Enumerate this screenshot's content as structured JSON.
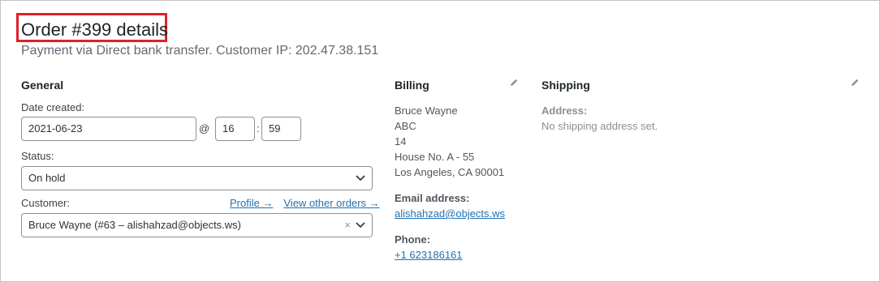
{
  "order": {
    "title": "Order #399 details",
    "subtitle": "Payment via Direct bank transfer. Customer IP: 202.47.38.151"
  },
  "general": {
    "heading": "General",
    "date_label": "Date created:",
    "date_value": "2021-06-23",
    "at_sign": "@",
    "hour": "16",
    "colon": ":",
    "minute": "59",
    "status_label": "Status:",
    "status_value": "On hold",
    "customer_label": "Customer:",
    "profile_link": "Profile →",
    "view_orders_link": "View other orders →",
    "customer_value": "Bruce Wayne (#63 – alishahzad@objects.ws)",
    "clear_symbol": "×"
  },
  "billing": {
    "heading": "Billing",
    "address_lines": [
      "Bruce Wayne",
      "ABC",
      "14",
      "House No. A - 55",
      "Los Angeles, CA 90001"
    ],
    "email_label": "Email address:",
    "email": "alishahzad@objects.ws",
    "phone_label": "Phone:",
    "phone": "+1 623186161"
  },
  "shipping": {
    "heading": "Shipping",
    "address_label": "Address:",
    "address_value": "No shipping address set."
  },
  "icons": {
    "edit": "pencil-icon",
    "dropdown": "chevron-down-icon",
    "clear": "clear-icon"
  },
  "colors": {
    "highlight": "#e0202a",
    "link": "#2271b1"
  }
}
